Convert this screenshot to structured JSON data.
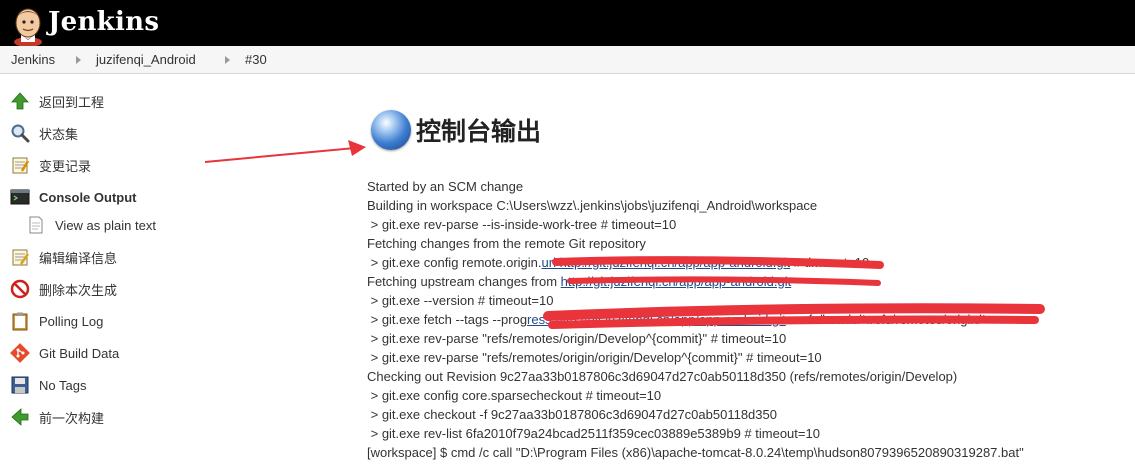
{
  "header": {
    "brand": "Jenkins"
  },
  "breadcrumb": [
    {
      "label": "Jenkins"
    },
    {
      "label": "juzifenqi_Android"
    },
    {
      "label": "#30"
    }
  ],
  "sidebar": {
    "items": [
      {
        "label": "返回到工程",
        "icon": "up-arrow-icon"
      },
      {
        "label": "状态集",
        "icon": "magnifier-icon"
      },
      {
        "label": "变更记录",
        "icon": "notepad-icon"
      },
      {
        "label": "Console Output",
        "icon": "terminal-icon"
      },
      {
        "label": "View as plain text",
        "icon": "document-icon"
      },
      {
        "label": "编辑编译信息",
        "icon": "notepad-pencil-icon"
      },
      {
        "label": "删除本次生成",
        "icon": "no-entry-icon"
      },
      {
        "label": "Polling Log",
        "icon": "clipboard-icon"
      },
      {
        "label": "Git Build Data",
        "icon": "git-icon"
      },
      {
        "label": "No Tags",
        "icon": "floppy-disk-icon"
      },
      {
        "label": "前一次构建",
        "icon": "left-arrow-icon"
      }
    ]
  },
  "main": {
    "title": "控制台输出",
    "console": [
      {
        "text": "Started by an SCM change"
      },
      {
        "text": "Building in workspace C:\\Users\\wzz\\.jenkins\\jobs\\juzifenqi_Android\\workspace"
      },
      {
        "text": " > git.exe rev-parse --is-inside-work-tree # timeout=10"
      },
      {
        "text": "Fetching changes from the remote Git repository"
      },
      {
        "text": " > git.exe config remote.origin.",
        "link": "url http://git.juzifenqi.cn/app/app-android.git",
        "after": " # timeout=10"
      },
      {
        "text": "Fetching upstream changes from ",
        "link": "http://git.juzifenqi.cn/app/app-android.git",
        "after": ""
      },
      {
        "text": " > git.exe --version # timeout=10"
      },
      {
        "text": " > git.exe fetch --tags --prog",
        "link": "ress http://git.juzifenqi.cn/app/app-android.git",
        "after": " +refs/heads/*:refs/remotes/origin/*"
      },
      {
        "text": " > git.exe rev-parse \"refs/remotes/origin/Develop^{commit}\" # timeout=10"
      },
      {
        "text": " > git.exe rev-parse \"refs/remotes/origin/origin/Develop^{commit}\" # timeout=10"
      },
      {
        "text": "Checking out Revision 9c27aa33b0187806c3d69047d27c0ab50118d350 (refs/remotes/origin/Develop)"
      },
      {
        "text": " > git.exe config core.sparsecheckout # timeout=10"
      },
      {
        "text": " > git.exe checkout -f 9c27aa33b0187806c3d69047d27c0ab50118d350"
      },
      {
        "text": " > git.exe rev-list 6fa2010f79a24bcad2511f359cec03889e5389b9 # timeout=10"
      },
      {
        "text": "[workspace] $ cmd /c call \"D:\\Program Files (x86)\\apache-tomcat-8.0.24\\temp\\hudson8079396520890319287.bat\""
      }
    ]
  },
  "colors": {
    "header_bg": "#000000",
    "annotation_red": "#e8343a",
    "link": "#204a87"
  }
}
